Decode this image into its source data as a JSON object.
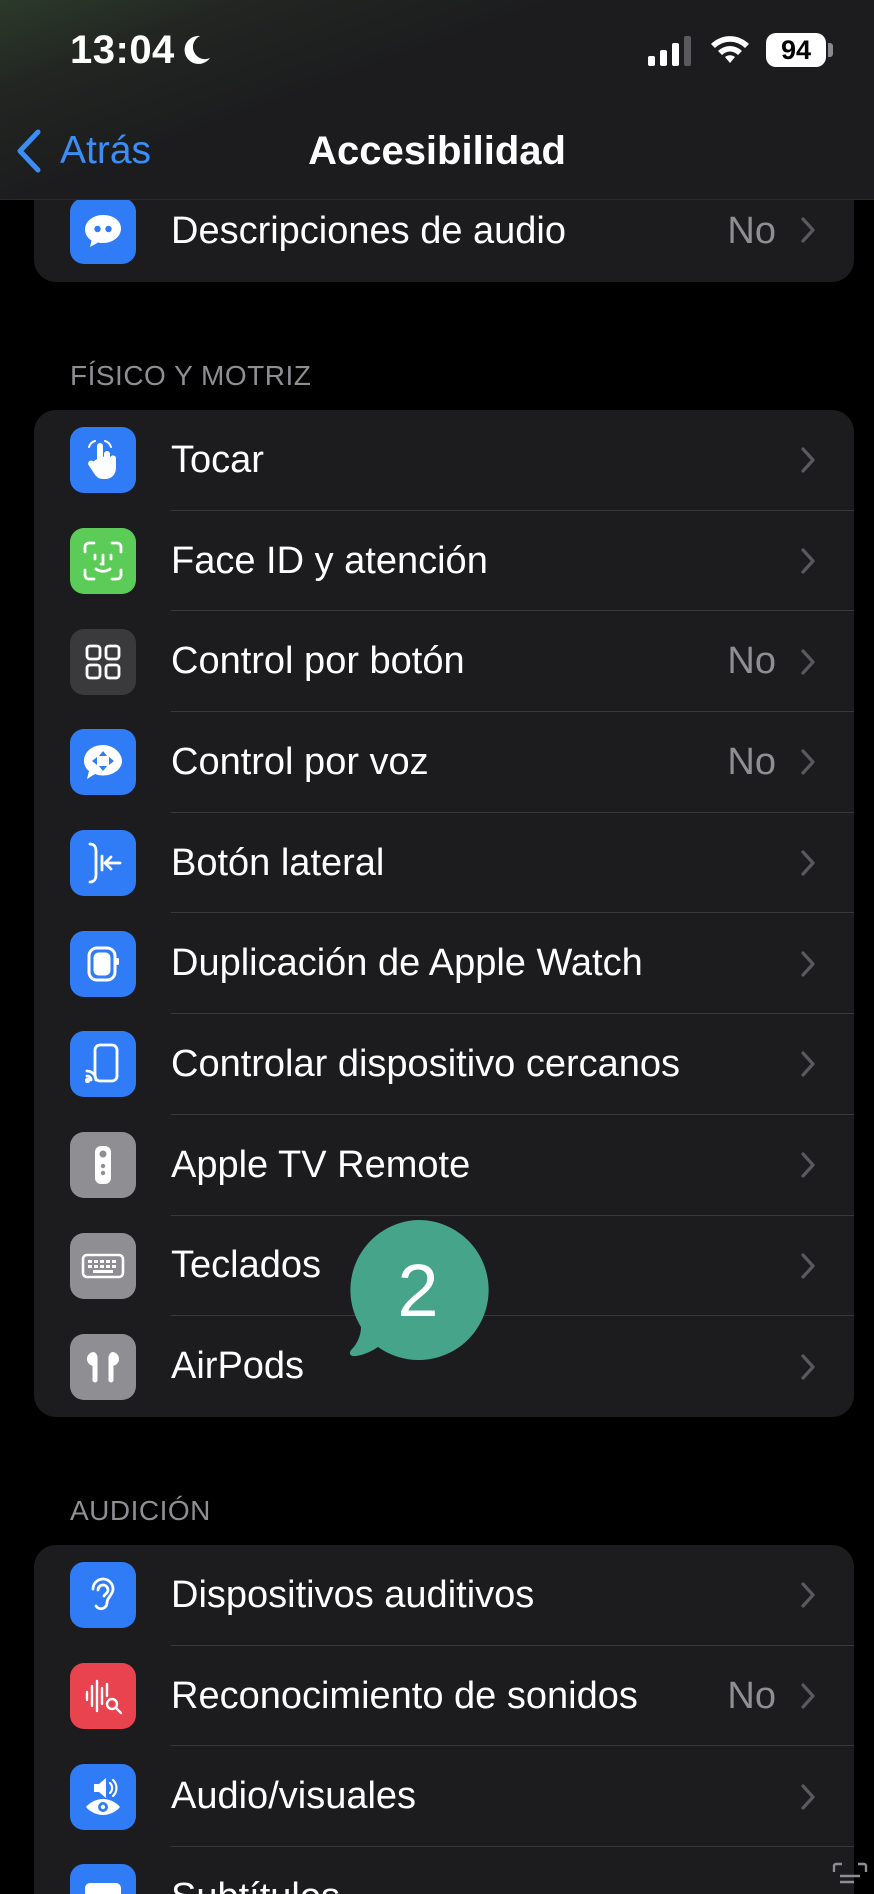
{
  "status_bar": {
    "time": "13:04",
    "battery": "94"
  },
  "nav": {
    "back_label": "Atrás",
    "title": "Accesibilidad"
  },
  "top_partial": {
    "label": "Descripciones de audio",
    "value": "No"
  },
  "sections": {
    "physical": {
      "header": "FÍSICO Y MOTRIZ",
      "items": [
        {
          "label": "Tocar",
          "value": "",
          "icon": "touch-hand-icon",
          "color": "#2f7cf6"
        },
        {
          "label": "Face ID y atención",
          "value": "",
          "icon": "face-id-icon",
          "color": "#5ccc58"
        },
        {
          "label": "Control por botón",
          "value": "No",
          "icon": "switch-control-icon",
          "color": "#3a3a3c"
        },
        {
          "label": "Control por voz",
          "value": "No",
          "icon": "voice-control-icon",
          "color": "#2f7cf6"
        },
        {
          "label": "Botón lateral",
          "value": "",
          "icon": "side-button-icon",
          "color": "#2f7cf6"
        },
        {
          "label": "Duplicación de Apple Watch",
          "value": "",
          "icon": "apple-watch-icon",
          "color": "#2f7cf6"
        },
        {
          "label": "Controlar dispositivo cercanos",
          "value": "",
          "icon": "nearby-device-icon",
          "color": "#2f7cf6"
        },
        {
          "label": "Apple TV Remote",
          "value": "",
          "icon": "tv-remote-icon",
          "color": "#8e8e93"
        },
        {
          "label": "Teclados",
          "value": "",
          "icon": "keyboard-icon",
          "color": "#8e8e93"
        },
        {
          "label": "AirPods",
          "value": "",
          "icon": "airpods-icon",
          "color": "#8e8e93"
        }
      ]
    },
    "hearing": {
      "header": "AUDICIÓN",
      "items": [
        {
          "label": "Dispositivos auditivos",
          "value": "",
          "icon": "ear-icon",
          "color": "#2f7cf6"
        },
        {
          "label": "Reconocimiento de sonidos",
          "value": "No",
          "icon": "sound-recognition-icon",
          "color": "#e8434f"
        },
        {
          "label": "Audio/visuales",
          "value": "",
          "icon": "audio-visual-icon",
          "color": "#2f7cf6"
        },
        {
          "label": "Subtítulos",
          "value": "",
          "icon": "subtitles-icon",
          "color": "#2f7cf6"
        }
      ]
    }
  },
  "annotation": {
    "number": "2",
    "color": "#45a48a"
  }
}
